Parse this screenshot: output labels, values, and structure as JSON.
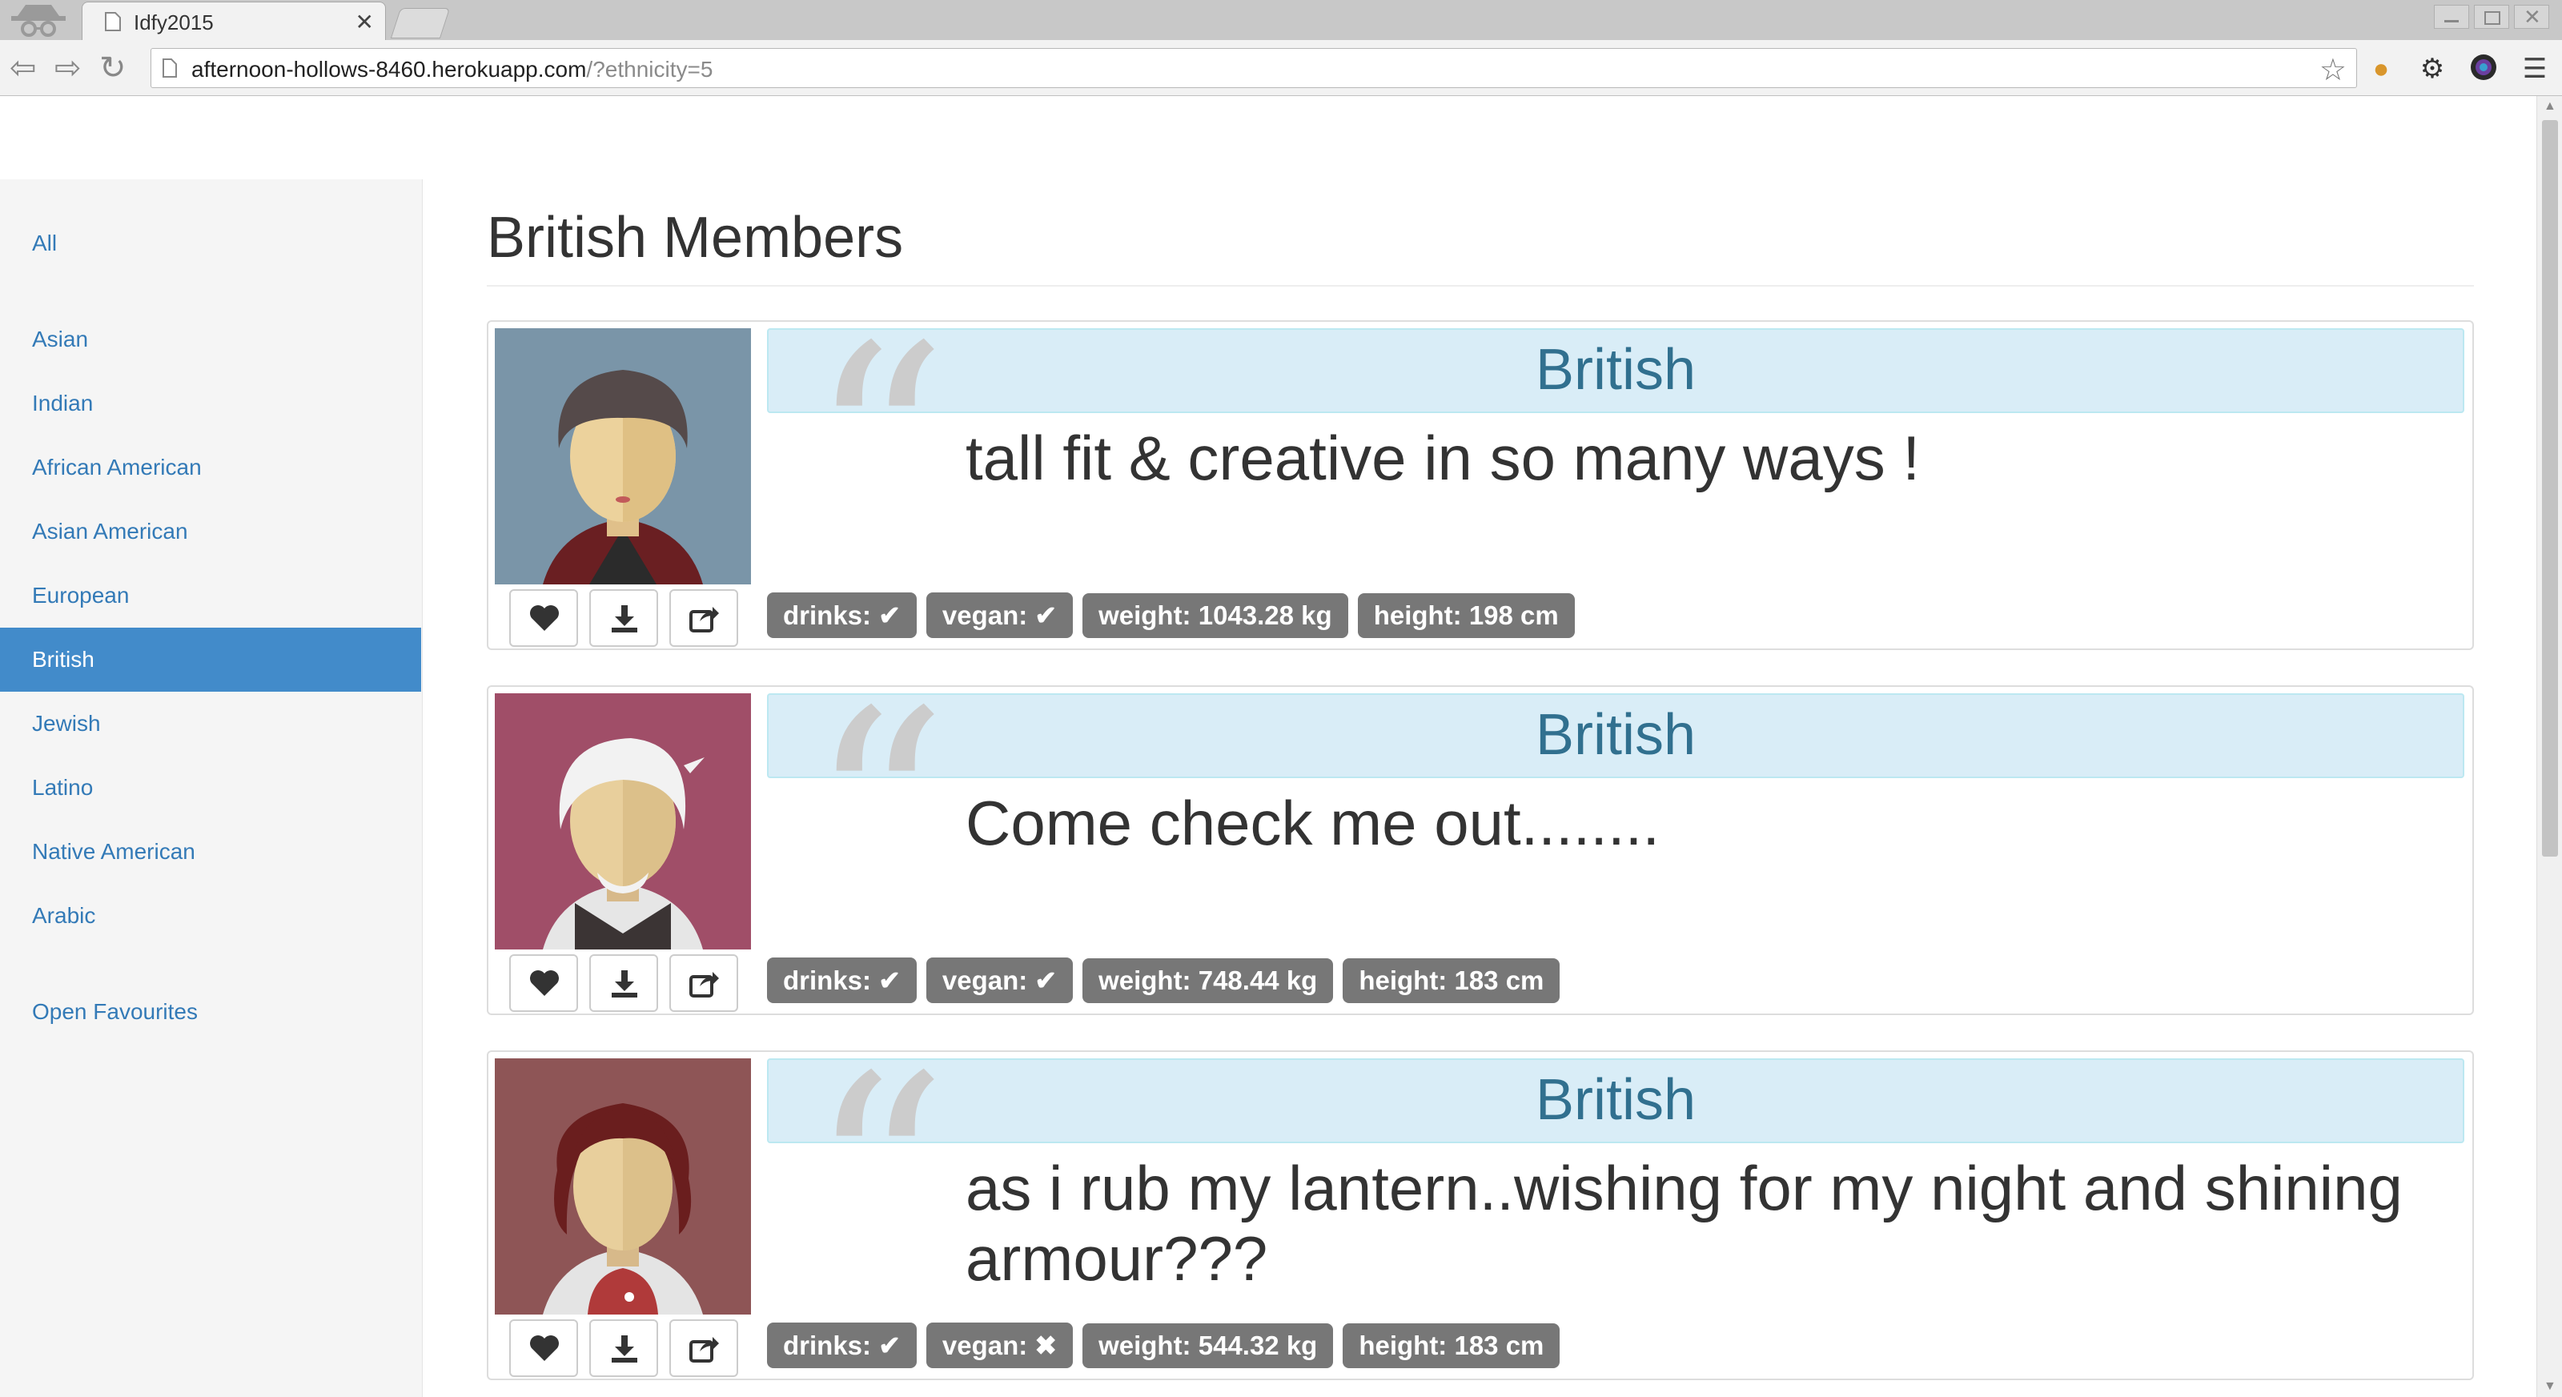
{
  "browser": {
    "tab_title": "Idfy2015",
    "url_host": "afternoon-hollows-8460.herokuapp.com",
    "url_path": "/?ethnicity=5"
  },
  "sidebar": {
    "items": [
      {
        "label": "All",
        "active": false
      },
      {
        "label": "Asian",
        "active": false
      },
      {
        "label": "Indian",
        "active": false
      },
      {
        "label": "African American",
        "active": false
      },
      {
        "label": "Asian American",
        "active": false
      },
      {
        "label": "European",
        "active": false
      },
      {
        "label": "British",
        "active": true
      },
      {
        "label": "Jewish",
        "active": false
      },
      {
        "label": "Latino",
        "active": false
      },
      {
        "label": "Native American",
        "active": false
      },
      {
        "label": "Arabic",
        "active": false
      },
      {
        "label": "Open Favourites",
        "active": false
      }
    ]
  },
  "main": {
    "title": "British Members",
    "members": [
      {
        "ethnicity": "British",
        "about": "tall fit & creative in so many ways !",
        "drinks": "drinks:",
        "drinks_icon": "check-icon",
        "vegan": "vegan:",
        "vegan_icon": "check-icon",
        "weight": "weight: 1043.28 kg",
        "height": "height: 198 cm",
        "avatar_bg": "#7a95a8"
      },
      {
        "ethnicity": "British",
        "about": "Come check me out........",
        "drinks": "drinks:",
        "drinks_icon": "check-icon",
        "vegan": "vegan:",
        "vegan_icon": "check-icon",
        "weight": "weight: 748.44 kg",
        "height": "height: 183 cm",
        "avatar_bg": "#a04e68"
      },
      {
        "ethnicity": "British",
        "about": "as i rub my lantern..wishing for my night and shining armour???",
        "drinks": "drinks:",
        "drinks_icon": "check-icon",
        "vegan": "vegan:",
        "vegan_icon": "cross-icon",
        "weight": "weight: 544.32 kg",
        "height": "height: 183 cm",
        "avatar_bg": "#8e5556"
      }
    ]
  },
  "colors": {
    "link": "#337ab7",
    "active_nav": "#428bca",
    "label_bg": "#777777",
    "info_bg": "#d9edf7",
    "info_text": "#31708f"
  }
}
